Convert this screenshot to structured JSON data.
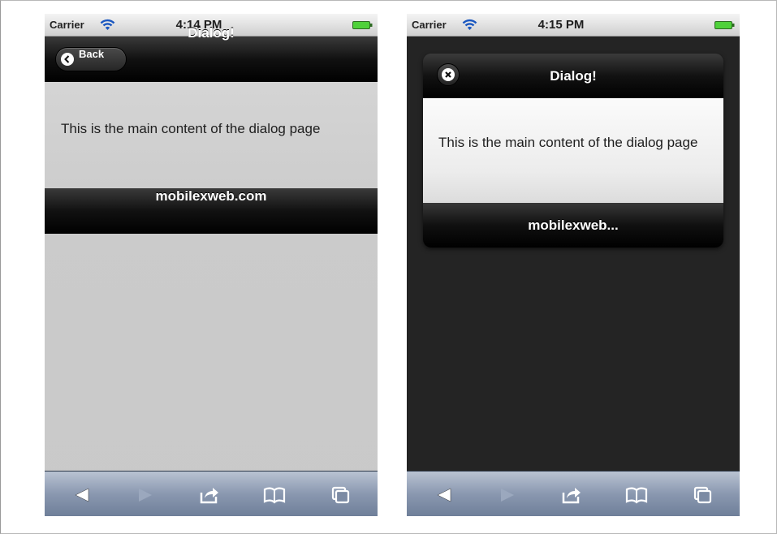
{
  "left_phone": {
    "status": {
      "carrier": "Carrier",
      "time": "4:14 PM"
    },
    "header": {
      "back_label": "Back",
      "title": "Dialog!"
    },
    "content": "This is the main content of the dialog page",
    "footer": "mobilexweb.com"
  },
  "right_phone": {
    "status": {
      "carrier": "Carrier",
      "time": "4:15 PM"
    },
    "dialog": {
      "title": "Dialog!",
      "content": "This is the main content of the dialog page",
      "footer": "mobilexweb..."
    }
  },
  "toolbar_icons": [
    "back-arrow-icon",
    "forward-arrow-icon",
    "share-icon",
    "bookmarks-icon",
    "tabs-icon"
  ],
  "colors": {
    "battery": "#4fd13a",
    "header_bar": "#000000",
    "toolbar": "#8a98b0",
    "right_background": "#242424",
    "left_background": "#cccccc"
  }
}
